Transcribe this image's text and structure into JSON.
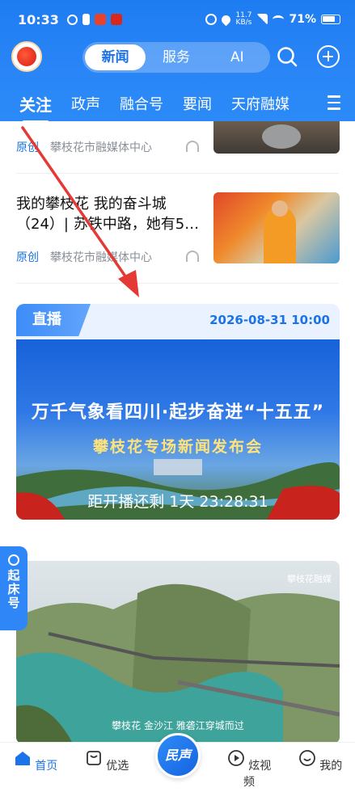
{
  "status_bar": {
    "time": "10:33",
    "network_speed": "11.7",
    "network_unit": "KB/s",
    "battery": "71%"
  },
  "header": {
    "segments": [
      "新闻",
      "服务",
      "AI"
    ],
    "active_segment": "新闻"
  },
  "tabs": [
    "关注",
    "政声",
    "融合号",
    "要闻",
    "天府融媒"
  ],
  "feed": {
    "item1": {
      "tag": "原创",
      "source": "攀枝花市融媒体中心"
    },
    "item2": {
      "title": "我的攀枝花 我的奋斗城（24）| 苏铁中路，她有5…",
      "tag": "原创",
      "source": "攀枝花市融媒体中心"
    },
    "live": {
      "label": "直播",
      "datetime": "2026-08-31 10:00",
      "banner_title": "万千气象看四川·起步奋进“十五五”",
      "banner_subtitle": "攀枝花专场新闻发布会",
      "countdown": "距开播还剩 1天 23:28:31"
    },
    "video": {
      "caption": "攀枝花 金沙江 雅砻江穿城而过",
      "watermark": "攀枝花融媒"
    }
  },
  "float_tag": "起床号",
  "bottom_nav": {
    "home": "首页",
    "selected": "优选",
    "center": "民声",
    "video": "炫视频",
    "mine": "我的"
  },
  "colors": {
    "brand_blue": "#1a73e8",
    "header_blue": "#2a86f7",
    "annotation_red": "#e53935"
  }
}
